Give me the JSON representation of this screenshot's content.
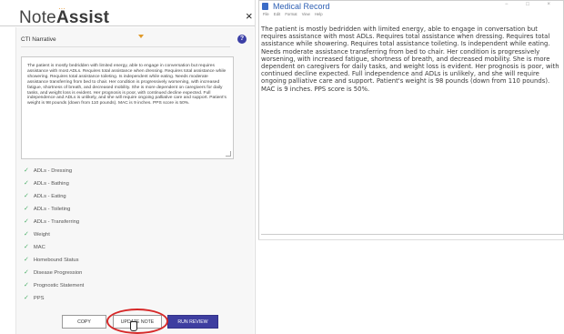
{
  "left_panel": {
    "brand_regular": "Note",
    "brand_bold": "Assist",
    "close": "×",
    "dropdown_value": "CTI Narrative",
    "help": "?",
    "note_text": "The patient is mostly bedridden with limited energy, able to engage in conversation but requires assistance with most ADLs. Requires total assistance when dressing. Requires total assistance while showering. Requires total assistance toileting. Is independent while eating. Needs moderate assistance transferring from bed to chair. Her condition is progressively worsening, with increased fatigue, shortness of breath, and decreased mobility. She is more dependent on caregivers for daily tasks, and weight loss is evident. Her prognosis is poor, with continued decline expected. Full independence and ADLs is unlikely, and she will require ongoing palliative care and support. Patient's weight is 98 pounds (down from 110 pounds). MAC is 9 inches. PPS score is 50%.",
    "checklist": [
      "ADLs - Dressing",
      "ADLs - Bathing",
      "ADLs - Eating",
      "ADLs - Toileting",
      "ADLs - Transferring",
      "Weight",
      "MAC",
      "Homebound Status",
      "Disease Progression",
      "Prognostic Statement",
      "PPS"
    ],
    "buttons": {
      "copy": "COPY",
      "update": "UPDATE NOTE",
      "review": "RUN REVIEW"
    }
  },
  "right_window": {
    "title": "Medical Record",
    "controls": "− □ ×",
    "menu": [
      "File",
      "Edit",
      "Format",
      "View",
      "Help"
    ],
    "content": "The patient is mostly bedridden with limited energy, able to engage in conversation but requires assistance with most ADLs. Requires total assistance when dressing. Requires total assistance while showering. Requires total assistance toileting. Is independent while eating. Needs moderate assistance transferring from bed to chair. Her condition is progressively worsening, with increased fatigue, shortness of breath, and decreased mobility. She is more dependent on caregivers for daily tasks, and weight loss is evident. Her prognosis is poor, with continued decline expected. Full independence and ADLs is unlikely, and she will require ongoing palliative care and support. Patient's weight is 98 pounds (down from 110 pounds). MAC is 9 inches. PPS score is 50%."
  },
  "colors": {
    "accent": "#3e3ea0",
    "check": "#4db06a",
    "highlight": "#d62828",
    "caret": "#e09a2a"
  }
}
